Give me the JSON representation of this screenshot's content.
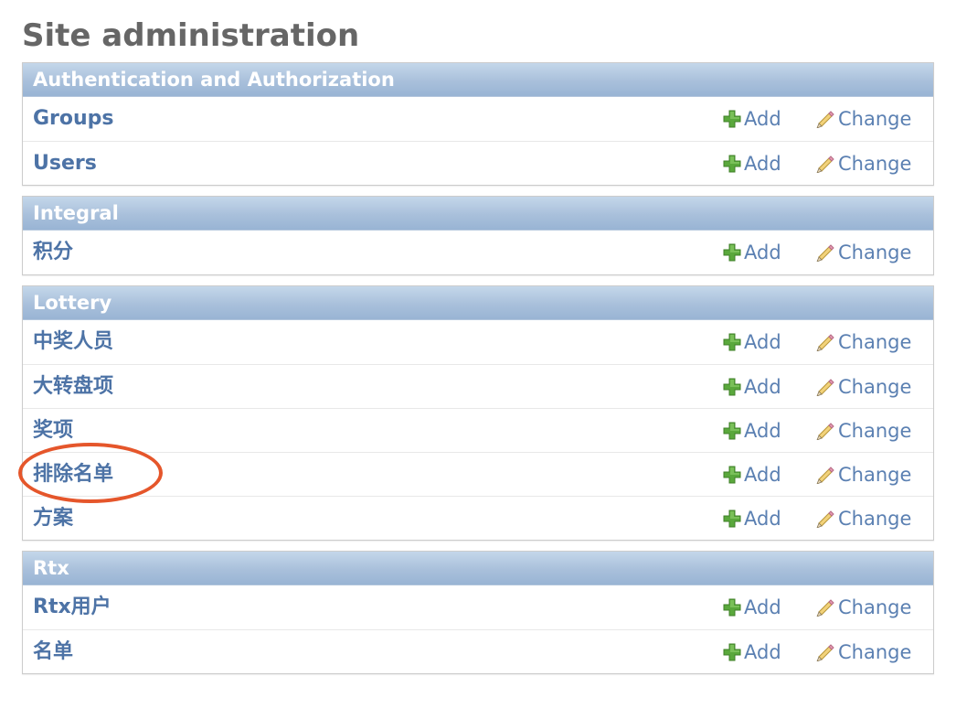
{
  "page": {
    "title": "Site administration"
  },
  "actions": {
    "add_label": "Add",
    "change_label": "Change"
  },
  "icons": {
    "add": "plus-icon",
    "change": "pencil-icon"
  },
  "colors": {
    "header_gradient_top": "#c4d7ea",
    "header_gradient_bottom": "#99b4d4",
    "link": "#4d73a6",
    "add_icon": "#5aa83c",
    "annotation": "#e5562b"
  },
  "modules": [
    {
      "name": "Authentication and Authorization",
      "models": [
        {
          "name": "Groups"
        },
        {
          "name": "Users"
        }
      ]
    },
    {
      "name": "Integral",
      "models": [
        {
          "name": "积分"
        }
      ]
    },
    {
      "name": "Lottery",
      "models": [
        {
          "name": "中奖人员"
        },
        {
          "name": "大转盘项"
        },
        {
          "name": "奖项"
        },
        {
          "name": "排除名单",
          "highlighted": true
        },
        {
          "name": "方案"
        }
      ]
    },
    {
      "name": "Rtx",
      "models": [
        {
          "name": "Rtx用户"
        },
        {
          "name": "名单"
        }
      ]
    }
  ]
}
